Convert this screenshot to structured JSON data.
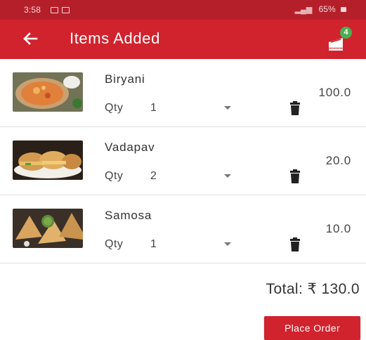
{
  "status_bar": {
    "time": "3:58",
    "battery": "65%",
    "icons": [
      "gallery-icon",
      "notification-icon",
      "wifi-icon",
      "signal-icon",
      "lock-icon"
    ]
  },
  "app_bar": {
    "title": "Items Added",
    "cart_count": "4",
    "icons": [
      "back-arrow-icon",
      "cart-icon"
    ]
  },
  "items": [
    {
      "name": "Biryani",
      "qty_label": "Qty",
      "qty": "1",
      "price": "100.0",
      "image": "biryani-photo"
    },
    {
      "name": "Vadapav",
      "qty_label": "Qty",
      "qty": "2",
      "price": "20.0",
      "image": "vadapav-photo"
    },
    {
      "name": "Samosa",
      "qty_label": "Qty",
      "qty": "1",
      "price": "10.0",
      "image": "samosa-photo"
    }
  ],
  "total": "Total: ₹ 130.0",
  "place_order_label": "Place Order",
  "colors": {
    "primary": "#d0232e",
    "status_bar": "#b51f2a",
    "badge": "#4caf50"
  }
}
